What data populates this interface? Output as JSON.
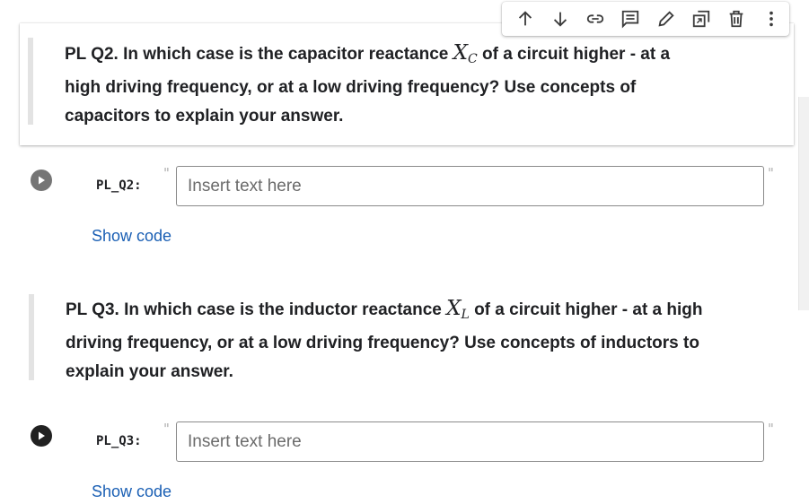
{
  "toolbar": {
    "buttons": [
      {
        "icon": "arrow-up-icon",
        "title": "Move cell up"
      },
      {
        "icon": "arrow-down-icon",
        "title": "Move cell down"
      },
      {
        "icon": "link-icon",
        "title": "Copy link to cell"
      },
      {
        "icon": "comment-icon",
        "title": "Add a comment"
      },
      {
        "icon": "pencil-icon",
        "title": "Edit"
      },
      {
        "icon": "mirror-cell-icon",
        "title": "Mirror cell in tab"
      },
      {
        "icon": "trash-icon",
        "title": "Delete cell"
      },
      {
        "icon": "more-vert-icon",
        "title": "More cell actions"
      }
    ]
  },
  "cells": [
    {
      "question_prefix": "PL Q2. In which case is the capacitor reactance ",
      "math_symbol": "X",
      "math_subscript": "C",
      "question_suffix_line1": " of a circuit higher - at a",
      "question_line2": "high driving frequency, or at a low driving frequency? Use concepts of",
      "question_line3": "capacitors to explain your answer.",
      "field_label": "PL_Q2:",
      "placeholder": "Insert text here",
      "value": "",
      "show_code": "Show code"
    },
    {
      "question_prefix": "PL Q3. In which case is the inductor reactance ",
      "math_symbol": "X",
      "math_subscript": "L",
      "question_suffix_line1": " of a circuit higher - at a high",
      "question_line2": "driving frequency, or at a low driving frequency? Use concepts of inductors to",
      "question_line3": "explain your answer.",
      "field_label": "PL_Q3:",
      "placeholder": "Insert text here",
      "value": "",
      "show_code": "Show code"
    }
  ],
  "quote_char": "\"",
  "colors": {
    "link": "#1a5fb4",
    "run_idle": "#757575",
    "run_active": "#212121"
  }
}
